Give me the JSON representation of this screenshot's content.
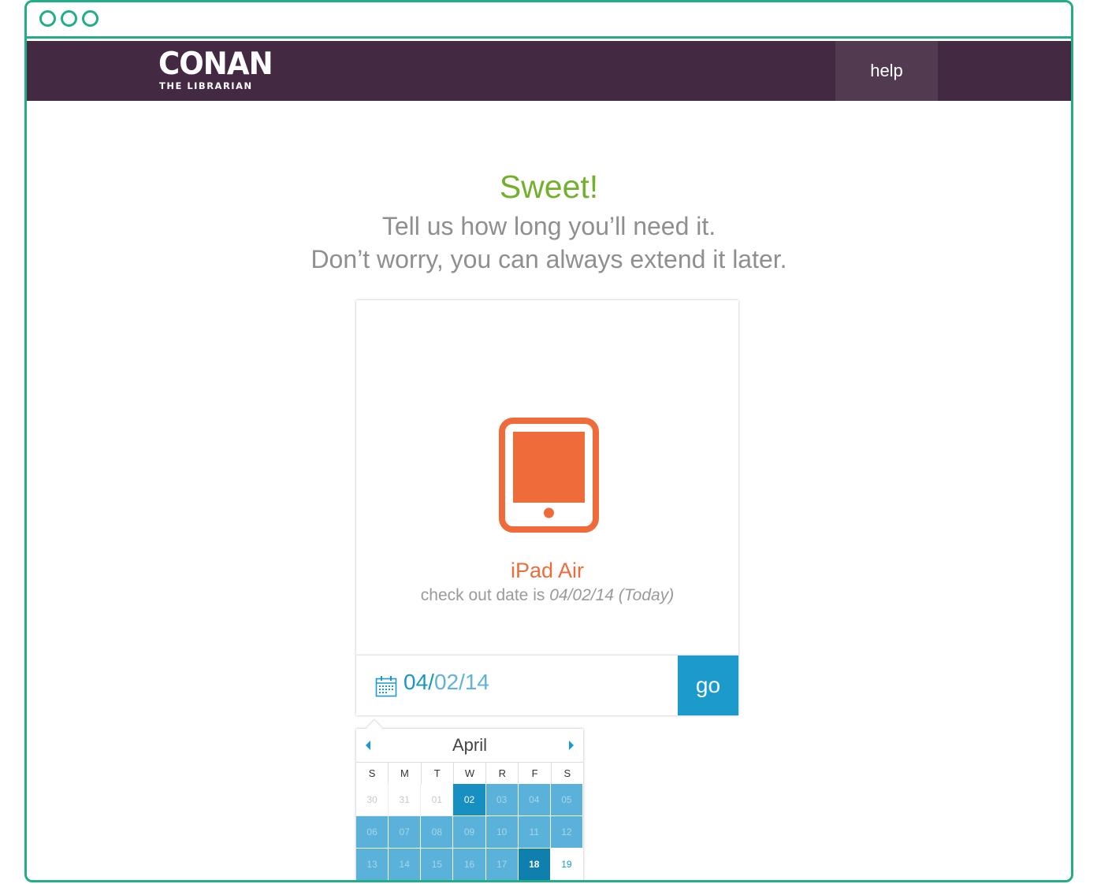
{
  "window": {
    "frame_color": "#22ad86"
  },
  "nav": {
    "bg_color": "#432a42",
    "logo_main": "CONAN",
    "logo_sub": "THE LIBRARIAN",
    "help_label": "help"
  },
  "main": {
    "heading": "Sweet!",
    "subheading_line1": "Tell us how long you’ll need it.",
    "subheading_line2": "Don’t worry, you can always extend it later."
  },
  "product": {
    "icon": "tablet-icon",
    "name": "iPad Air",
    "checkout_prefix": "check out date is",
    "checkout_date": "04/02/14 (Today)",
    "accent_color": "#ef6b3a"
  },
  "date_field": {
    "value_first": "04/",
    "value_rest": "02/14",
    "icon": "calendar-icon",
    "go_label": "go"
  },
  "calendar": {
    "month": "April",
    "prev_icon": "prev-month-arrow-icon",
    "next_icon": "next-month-arrow-icon",
    "weekdays": [
      "S",
      "M",
      "T",
      "W",
      "R",
      "F",
      "S"
    ],
    "weeks": [
      [
        {
          "d": "30",
          "s": "other"
        },
        {
          "d": "31",
          "s": "other"
        },
        {
          "d": "01",
          "s": "other"
        },
        {
          "d": "02",
          "s": "today"
        },
        {
          "d": "03",
          "s": "range"
        },
        {
          "d": "04",
          "s": "range"
        },
        {
          "d": "05",
          "s": "range"
        }
      ],
      [
        {
          "d": "06",
          "s": "range"
        },
        {
          "d": "07",
          "s": "range"
        },
        {
          "d": "08",
          "s": "range"
        },
        {
          "d": "09",
          "s": "range"
        },
        {
          "d": "10",
          "s": "range"
        },
        {
          "d": "11",
          "s": "range"
        },
        {
          "d": "12",
          "s": "range"
        }
      ],
      [
        {
          "d": "13",
          "s": "range"
        },
        {
          "d": "14",
          "s": "range"
        },
        {
          "d": "15",
          "s": "range"
        },
        {
          "d": "16",
          "s": "range"
        },
        {
          "d": "17",
          "s": "range"
        },
        {
          "d": "18",
          "s": "selected"
        },
        {
          "d": "19",
          "s": "after"
        }
      ]
    ],
    "range_color": "#5ab1d9",
    "selected_color": "#0f7fae"
  }
}
